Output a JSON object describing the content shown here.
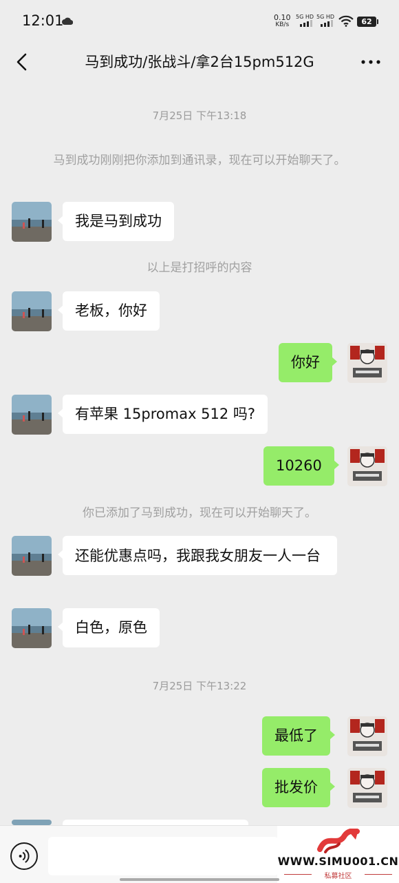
{
  "status_bar": {
    "time": "12:01",
    "net_speed_value": "0.10",
    "net_speed_unit": "KB/s",
    "sim1": "5G HD",
    "sim2": "5G HD",
    "battery": "62"
  },
  "header": {
    "title": "马到成功/张战斗/拿2台15pm512G",
    "back_icon": "chevron-left-icon",
    "more_icon": "more-horizontal-icon"
  },
  "timestamps": [
    "7月25日 下午13:18",
    "7月25日 下午13:22"
  ],
  "system_messages": [
    "马到成功刚刚把你添加到通讯录，现在可以开始聊天了。",
    "以上是打招呼的内容",
    "你已添加了马到成功，现在可以开始聊天了。"
  ],
  "messages": [
    {
      "side": "in",
      "text": "我是马到成功"
    },
    {
      "side": "in",
      "text": "老板，你好"
    },
    {
      "side": "out",
      "text": "你好"
    },
    {
      "side": "in",
      "text": "有苹果 15promax 512 吗?"
    },
    {
      "side": "out",
      "text": "10260"
    },
    {
      "side": "in",
      "text": "还能优惠点吗，我跟我女朋友一人一台"
    },
    {
      "side": "in",
      "text": "白色，原色"
    },
    {
      "side": "out",
      "text": "最低了"
    },
    {
      "side": "out",
      "text": "批发价"
    }
  ],
  "input_bar": {
    "voice_icon": "voice-icon",
    "placeholder": ""
  },
  "watermark": {
    "text": "WWW.SIMU001.CN",
    "sub": "私募社区"
  },
  "colors": {
    "background": "#ededed",
    "incoming_bubble": "#ffffff",
    "outgoing_bubble": "#95ec69",
    "system_text": "#a0a0a0"
  }
}
